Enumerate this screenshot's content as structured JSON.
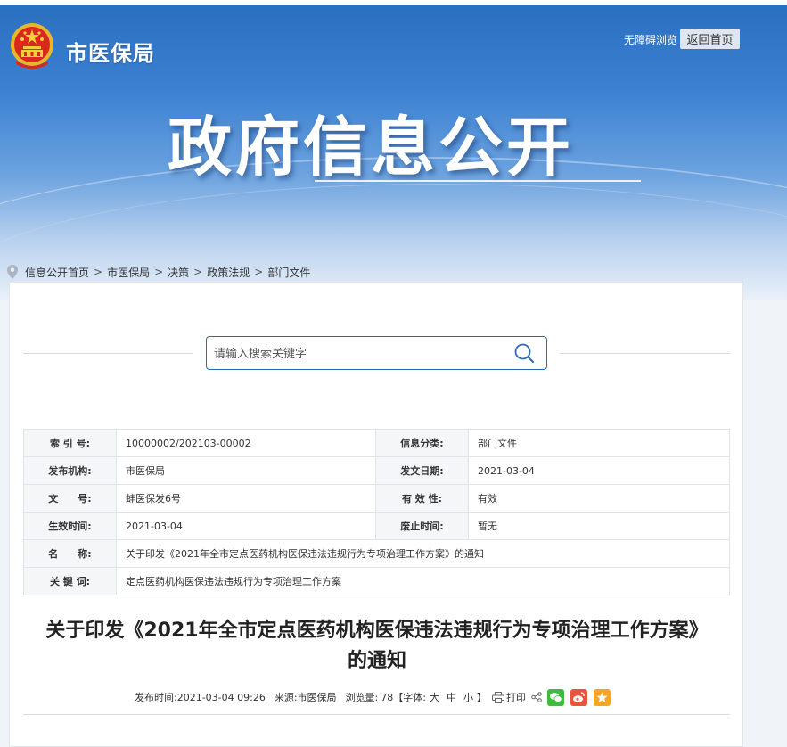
{
  "header": {
    "site_name": "市医保局",
    "accessible_link": "无障碍浏览",
    "home_button": "返回首页",
    "banner_title": "政府信息公开"
  },
  "breadcrumb": [
    "信息公开首页",
    "市医保局",
    "决策",
    "政策法规",
    "部门文件"
  ],
  "breadcrumb_sep": ">",
  "search": {
    "placeholder": "请输入搜索关键字"
  },
  "meta": {
    "index_no": {
      "label": "索 引 号:",
      "value": "10000002/202103-00002"
    },
    "category": {
      "label": "信息分类:",
      "value": "部门文件"
    },
    "publisher": {
      "label": "发布机构:",
      "value": "市医保局"
    },
    "issue_date": {
      "label": "发文日期:",
      "value": "2021-03-04"
    },
    "doc_no": {
      "label": "文　　号:",
      "value": "蚌医保发6号"
    },
    "validity": {
      "label": "有 效 性:",
      "value": "有效"
    },
    "effective_date": {
      "label": "生效时间:",
      "value": "2021-03-04"
    },
    "expiry_date": {
      "label": "废止时间:",
      "value": "暂无"
    },
    "name": {
      "label": "名　　称:",
      "value": "关于印发《2021年全市定点医药机构医保违法违规行为专项治理工作方案》的通知"
    },
    "keywords": {
      "label": "关 键 词:",
      "value": "定点医药机构医保违法违规行为专项治理工作方案"
    }
  },
  "article": {
    "title_line1": "关于印发《2021年全市定点医药机构医保违法违规行为专项治理工作方案》",
    "title_line2": "的通知",
    "publish_time_label": "发布时间:",
    "publish_time": "2021-03-04 09:26",
    "source_label": "来源:",
    "source": "市医保局",
    "views_label": "浏览量:",
    "views": "78",
    "font_label_open": "【字体:",
    "font_large": "大",
    "font_medium": "中",
    "font_small": "小",
    "font_label_close": "】",
    "print_label": "打印"
  },
  "colors": {
    "banner_top": "#2a6fc0",
    "search_border": "#2b6cb0",
    "wechat": "#3dbb3d",
    "weibo": "#e8543c",
    "favorite": "#f5a623"
  }
}
